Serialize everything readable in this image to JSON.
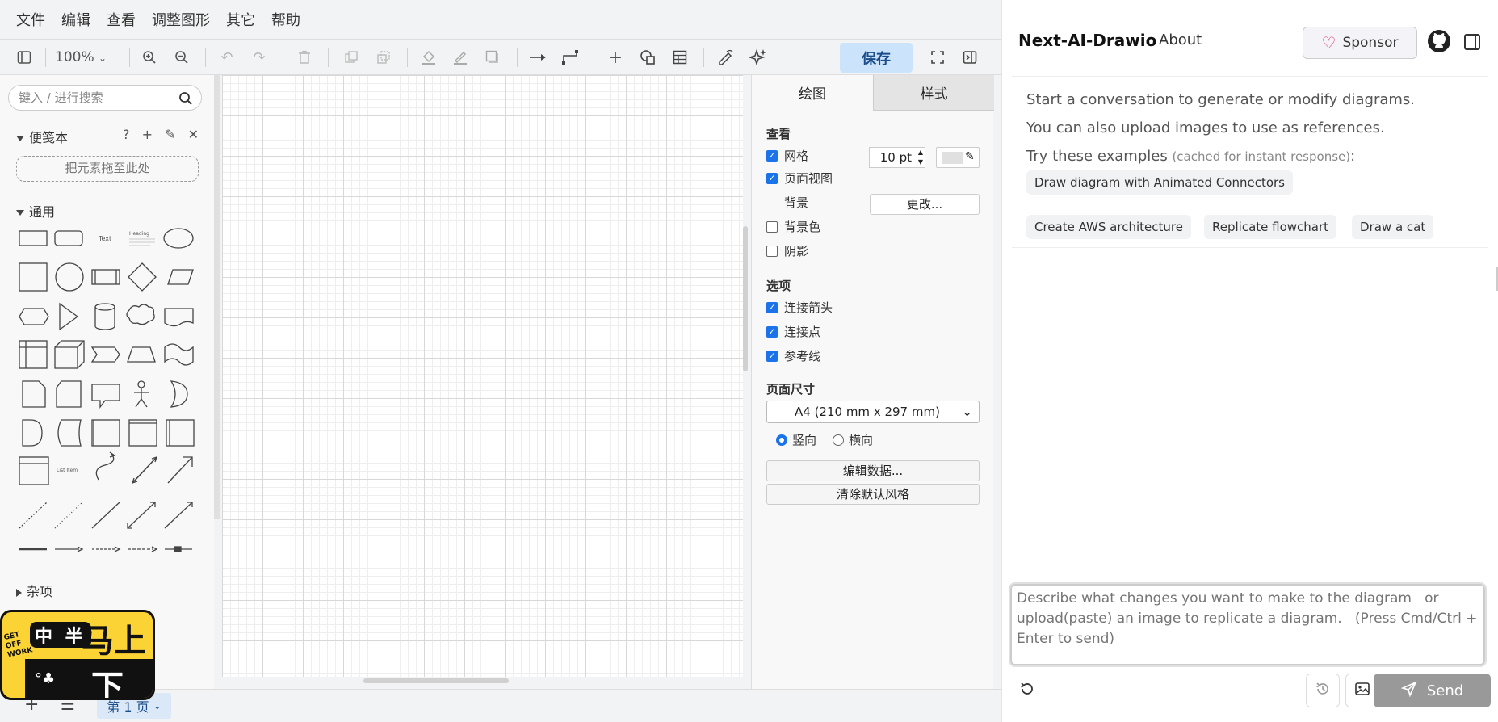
{
  "menu": [
    "文件",
    "编辑",
    "查看",
    "调整图形",
    "其它",
    "帮助"
  ],
  "toolbar": {
    "zoom": "100%",
    "save_label": "保存",
    "icons": [
      "format-panel-icon",
      "zoom-in-icon",
      "zoom-out-icon",
      "undo-icon",
      "redo-icon",
      "delete-icon",
      "to-front-icon",
      "to-back-icon",
      "fill-color-icon",
      "line-color-icon",
      "shadow-icon",
      "connection-icon",
      "waypoints-icon",
      "insert-icon",
      "shapes-icon",
      "table-icon",
      "freehand-icon",
      "ai-icon",
      "fullscreen-icon",
      "toggle-panel-icon"
    ]
  },
  "sidebar": {
    "search_placeholder": "键入 / 进行搜索",
    "scratchpad_title": "便笺本",
    "scratchpad_icons": "? + ✎ ✕",
    "dropzone_label": "把元素拖至此处",
    "general_title": "通用",
    "misc_title": "杂项",
    "shape_text_1": "Text",
    "shape_text_2": "Heading",
    "shape_text_3": "List Item"
  },
  "format": {
    "tab_draw": "绘图",
    "tab_style": "样式",
    "view_title": "查看",
    "grid_label": "网格",
    "grid_size": "10 pt",
    "pageview_label": "页面视图",
    "background_label": "背景",
    "change_button": "更改...",
    "bgcolor_label": "背景色",
    "shadow_label": "阴影",
    "options_title": "选项",
    "conn_arrows_label": "连接箭头",
    "conn_points_label": "连接点",
    "guides_label": "参考线",
    "pagesize_title": "页面尺寸",
    "pagesize_value": "A4 (210 mm x 297 mm)",
    "portrait_label": "竖向",
    "landscape_label": "横向",
    "edit_data_button": "编辑数据...",
    "clear_style_button": "清除默认风格"
  },
  "bottombar": {
    "page_tab": "第 1 页"
  },
  "sticker": {
    "top_small": "中 半",
    "big_top": "马上",
    "big_bottom": "下班",
    "badge": "GET OFF WORK"
  },
  "chat": {
    "brand": "Next-AI-Drawio",
    "about": "About",
    "sponsor": "Sponsor",
    "intro_1": "Start a conversation to generate or modify diagrams.",
    "intro_2": "You can also upload images to use as references.",
    "intro_3": "Try these examples",
    "intro_3_note": "(cached for instant response)",
    "intro_3_colon": ":",
    "example_1": "Draw diagram with Animated Connectors",
    "example_2": "Create AWS architecture",
    "example_3": "Replicate flowchart",
    "example_4": "Draw a cat",
    "input_placeholder": "Describe what changes you want to make to the diagram   or upload(paste) an image to replicate a diagram.   (Press Cmd/Ctrl + Enter to send)",
    "send": "Send",
    "accent": "#d6336c"
  }
}
